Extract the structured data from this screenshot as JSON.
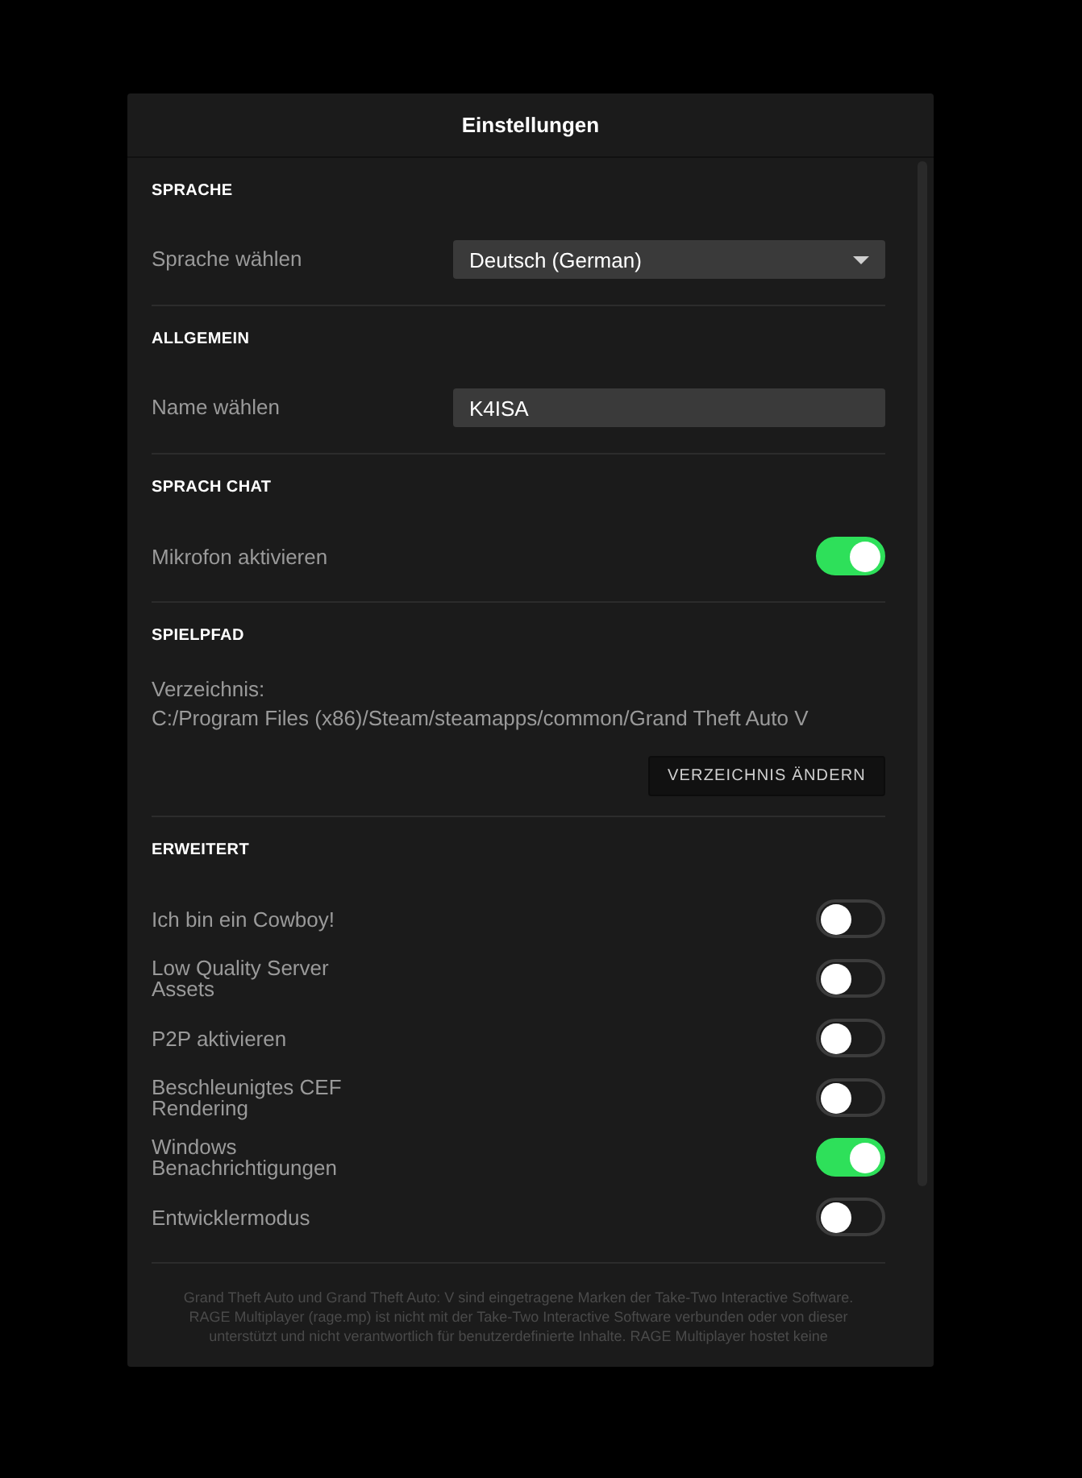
{
  "window": {
    "title": "Einstellungen"
  },
  "sections": [
    {
      "heading": "SPRACHE",
      "rows": [
        {
          "kind": "dropdown",
          "label": "Sprache wählen",
          "value": "Deutsch (German)"
        }
      ]
    },
    {
      "heading": "ALLGEMEIN",
      "rows": [
        {
          "kind": "text_input",
          "label": "Name wählen",
          "value": "K4ISA"
        }
      ]
    },
    {
      "heading": "SPRACH CHAT",
      "rows": [
        {
          "kind": "toggle",
          "label": "Mikrofon aktivieren",
          "on": true
        }
      ]
    },
    {
      "heading": "SPIELPFAD",
      "rows": [
        {
          "kind": "path",
          "label": "Verzeichnis:",
          "value": "C:/Program Files (x86)/Steam/steamapps/common/Grand Theft Auto V",
          "button": "VERZEICHNIS ÄNDERN"
        }
      ]
    },
    {
      "heading": "ERWEITERT",
      "rows": [
        {
          "kind": "toggle",
          "label": "Ich bin ein Cowboy!",
          "on": false
        },
        {
          "kind": "toggle",
          "label": "Low Quality Server Assets",
          "on": false
        },
        {
          "kind": "toggle",
          "label": "P2P aktivieren",
          "on": false
        },
        {
          "kind": "toggle",
          "label": "Beschleunigtes CEF Rendering",
          "on": false
        },
        {
          "kind": "toggle",
          "label": "Windows Benachrichtigungen",
          "on": true
        },
        {
          "kind": "toggle",
          "label": "Entwicklermodus",
          "on": false
        }
      ]
    }
  ],
  "footer": {
    "lines": [
      "Grand Theft Auto und Grand Theft Auto: V sind eingetragene Marken der Take-Two Interactive Software.",
      "RAGE Multiplayer (rage.mp) ist nicht mit der Take-Two Interactive Software verbunden oder von dieser",
      "unterstützt und nicht verantwortlich für benutzerdefinierte Inhalte. RAGE Multiplayer hostet keine"
    ]
  }
}
